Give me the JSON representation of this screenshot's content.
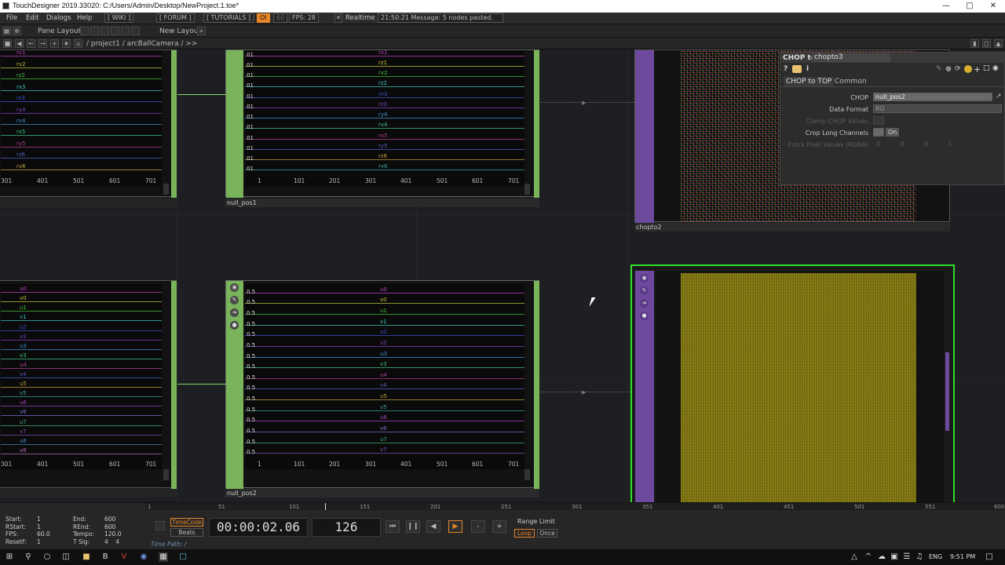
{
  "window": {
    "title": "TouchDesigner 2019.33020: C:/Users/Admin/Desktop/NewProject.1.toe*"
  },
  "menu": {
    "items": [
      "File",
      "Edit",
      "Dialogs",
      "Help"
    ],
    "wiki": "[ WIKI ]",
    "forum": "[ FORUM ]",
    "tutorials": "[ TUTORIALS ]",
    "fps_badge": "OI",
    "fps_60": "60",
    "fps": "FPS: 28",
    "realtime": "Realtime",
    "message": "21:50:21 Message: 5 nodes pasted."
  },
  "toolbar": {
    "pane_layout": "Pane Layout",
    "new_layout": "New Layout"
  },
  "path": {
    "project": "/ project1 / arcBallCamera / >>"
  },
  "nodes": {
    "top_left_chop": {
      "channels": [
        "rv1",
        "rv2",
        "rz2",
        "rx3",
        "rz3",
        "ry4",
        "rv4",
        "rx5",
        "ry5",
        "rz6",
        "rv6"
      ],
      "ticks": [
        "301",
        "401",
        "501",
        "601",
        "701"
      ]
    },
    "null_pos1": {
      "name": "null_pos1",
      "channels": [
        "rv1",
        "rz1",
        "rv2",
        "rz2",
        "rx3",
        "rz3",
        "ry4",
        "rv4",
        "rx5",
        "ry5",
        "rz6",
        "rv6"
      ],
      "ticks": [
        "1",
        "101",
        "201",
        "301",
        "401",
        "501",
        "601",
        "701"
      ],
      "value": "01"
    },
    "chopto2": {
      "name": "chopto2"
    },
    "bottom_left_chop": {
      "channels": [
        "u0",
        "v0",
        "u1",
        "v1",
        "u2",
        "v2",
        "u3",
        "v3",
        "u4",
        "v4",
        "u5",
        "v5",
        "u6",
        "v6",
        "u7",
        "v7",
        "u8",
        "v8"
      ],
      "ticks": [
        "301",
        "401",
        "501",
        "601",
        "701"
      ]
    },
    "null_pos2": {
      "name": "null_pos2",
      "channels": [
        "u0",
        "v0",
        "u1",
        "v1",
        "u2",
        "v2",
        "u3",
        "v3",
        "u4",
        "v4",
        "u5",
        "v5",
        "u6",
        "v6",
        "u7",
        "v7"
      ],
      "ticks": [
        "1",
        "101",
        "201",
        "301",
        "401",
        "501",
        "601",
        "701"
      ],
      "value": "0.5"
    },
    "chopto3": {
      "name": "chopto3"
    }
  },
  "params": {
    "type": "CHOP to",
    "name": "chopto3",
    "tabs": [
      "CHOP to TOP",
      "Common"
    ],
    "rows": [
      {
        "label": "CHOP",
        "value": "null_pos2",
        "dim": false
      },
      {
        "label": "Data Format",
        "value": "RG",
        "dim": false
      },
      {
        "label": "Clamp CHOP Values",
        "value": "",
        "dim": true
      },
      {
        "label": "Crop Long Channels",
        "value": "On",
        "dim": false
      },
      {
        "label": "Extra Pixel Values (RGBA)",
        "value": "0          0          0          1",
        "dim": true
      }
    ]
  },
  "timeline": {
    "ticks": [
      "1",
      "51",
      "101",
      "151",
      "201",
      "251",
      "301",
      "351",
      "401",
      "451",
      "501",
      "551",
      "600"
    ],
    "start": "Start:",
    "start_v": "1",
    "rstart": "RStart:",
    "rstart_v": "1",
    "fps_l": "FPS:",
    "fps_v": "60.0",
    "resetf": "ResetF:",
    "resetf_v": "1",
    "end": "End:",
    "end_v": "600",
    "rend": "REnd:",
    "rend_v": "600",
    "tempo": "Tempo:",
    "tempo_v": "120.0",
    "tsig": "T Sig:",
    "tsig_v": "4    4",
    "timecode_label": "TimeCode",
    "beats_label": "Beats",
    "timecode": "00:00:02.06",
    "frame": "126",
    "range_limit": "Range Limit",
    "loop": "Loop",
    "once": "Once",
    "time_path": "Time Path: /"
  },
  "taskbar": {
    "lang": "ENG",
    "time": "9:51 PM"
  },
  "colors": {
    "accent": "#e8862a",
    "selected_node": "#2fe02a",
    "wire": "#7fd86a",
    "top_sidebar": "#6e4a9e",
    "chop_sidebar": "#79b45a"
  }
}
